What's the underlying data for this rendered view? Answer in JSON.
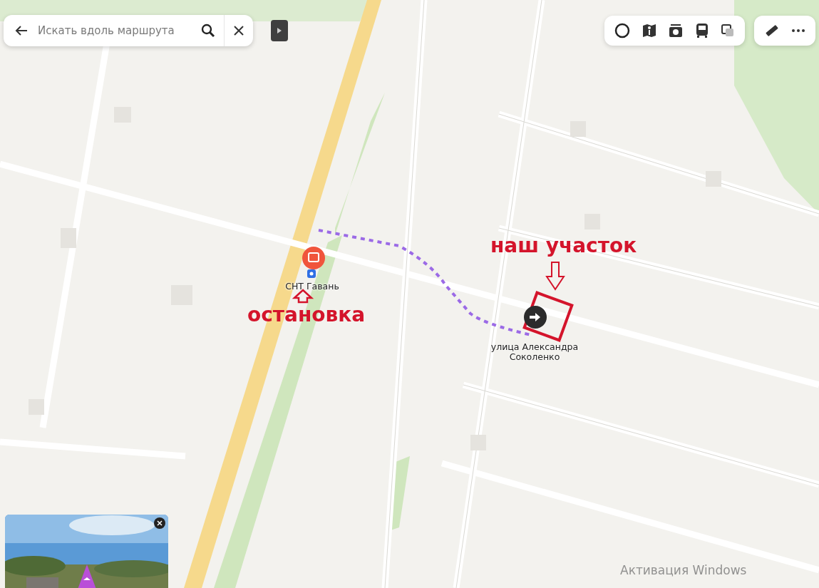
{
  "search": {
    "placeholder": "Искать вдоль маршрута"
  },
  "route": {
    "stop_label": "СНТ Гавань",
    "destination_label": "улица Александра Соколенко"
  },
  "annotations": {
    "plot_label": "наш участок",
    "stop_label": "остановка"
  },
  "system_notice": "Активация Windows"
}
